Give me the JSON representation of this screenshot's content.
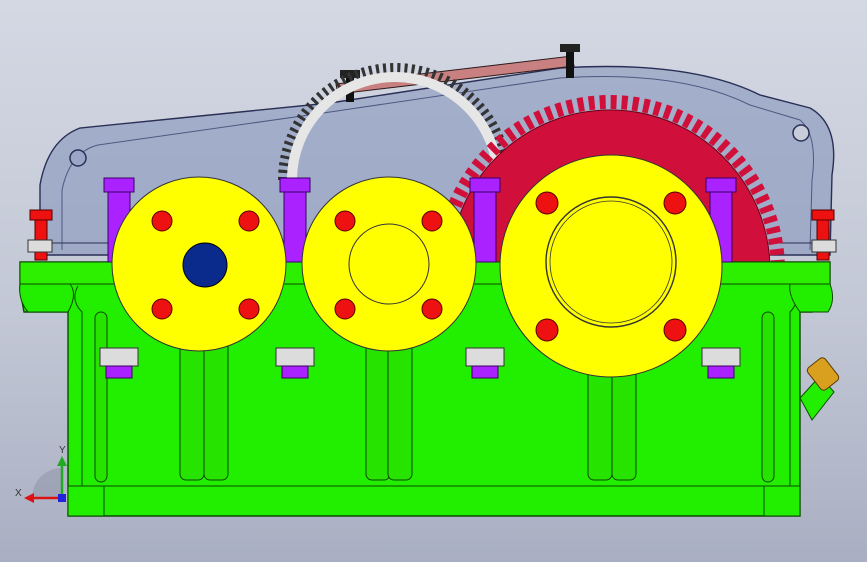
{
  "viewport": {
    "background_top": "#d4d8e3",
    "background_bottom": "#a9afc2"
  },
  "model": {
    "housing_color": "#22ee00",
    "cover_color": "#7f8fb8",
    "bearing_cap_color": "#ffff00",
    "cap_bolt_color": "#ee1111",
    "stud_color": "#aa22ff",
    "large_gear_color": "#d0103a",
    "idler_gear_color": "#dcdcdc",
    "input_shaft_color": "#0a2a8c",
    "sight_cover_color": "#c88080",
    "oil_plug_color": "#d9a020"
  },
  "triad": {
    "x_label": "X",
    "y_label": "Y",
    "x_color": "#dd1111",
    "y_color": "#22aa22",
    "z_color": "#2222dd"
  }
}
